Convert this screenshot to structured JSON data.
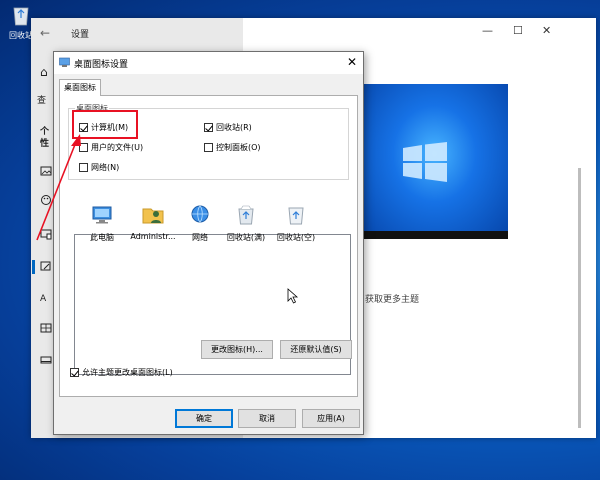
{
  "desktop": {
    "recycle_bin_label": "回收站"
  },
  "settings": {
    "title": "设置",
    "back_glyph": "←",
    "minimize_glyph": "—",
    "maximize_glyph": "☐",
    "close_glyph": "✕",
    "home_glyph": "⌂",
    "search_fragment": "查",
    "section_fragment": "个性",
    "get_more_themes": "获取更多主题"
  },
  "dialog": {
    "title": "桌面图标设置",
    "close_glyph": "✕",
    "tab_label": "桌面图标",
    "group_label": "桌面图标",
    "checkboxes": [
      {
        "label": "计算机(M)",
        "checked": true
      },
      {
        "label": "回收站(R)",
        "checked": true
      },
      {
        "label": "用户的文件(U)",
        "checked": false
      },
      {
        "label": "控制面板(O)",
        "checked": false
      },
      {
        "label": "网络(N)",
        "checked": false
      }
    ],
    "icons": [
      {
        "label": "此电脑",
        "icon": "computer-icon"
      },
      {
        "label": "Administr...",
        "icon": "user-folder-icon"
      },
      {
        "label": "网络",
        "icon": "network-icon"
      },
      {
        "label": "回收站(满)",
        "icon": "recycle-bin-full-icon"
      },
      {
        "label": "回收站(空)",
        "icon": "recycle-bin-empty-icon"
      }
    ],
    "change_icon_button": "更改图标(H)...",
    "restore_default_button": "还原默认值(S)",
    "allow_themes_checkbox": {
      "label": "允许主题更改桌面图标(L)",
      "checked": true
    },
    "ok_button": "确定",
    "cancel_button": "取消",
    "apply_button": "应用(A)"
  },
  "colors": {
    "accent": "#0078d7",
    "annotation": "#e81123",
    "desktop": "#0a5fc4"
  }
}
